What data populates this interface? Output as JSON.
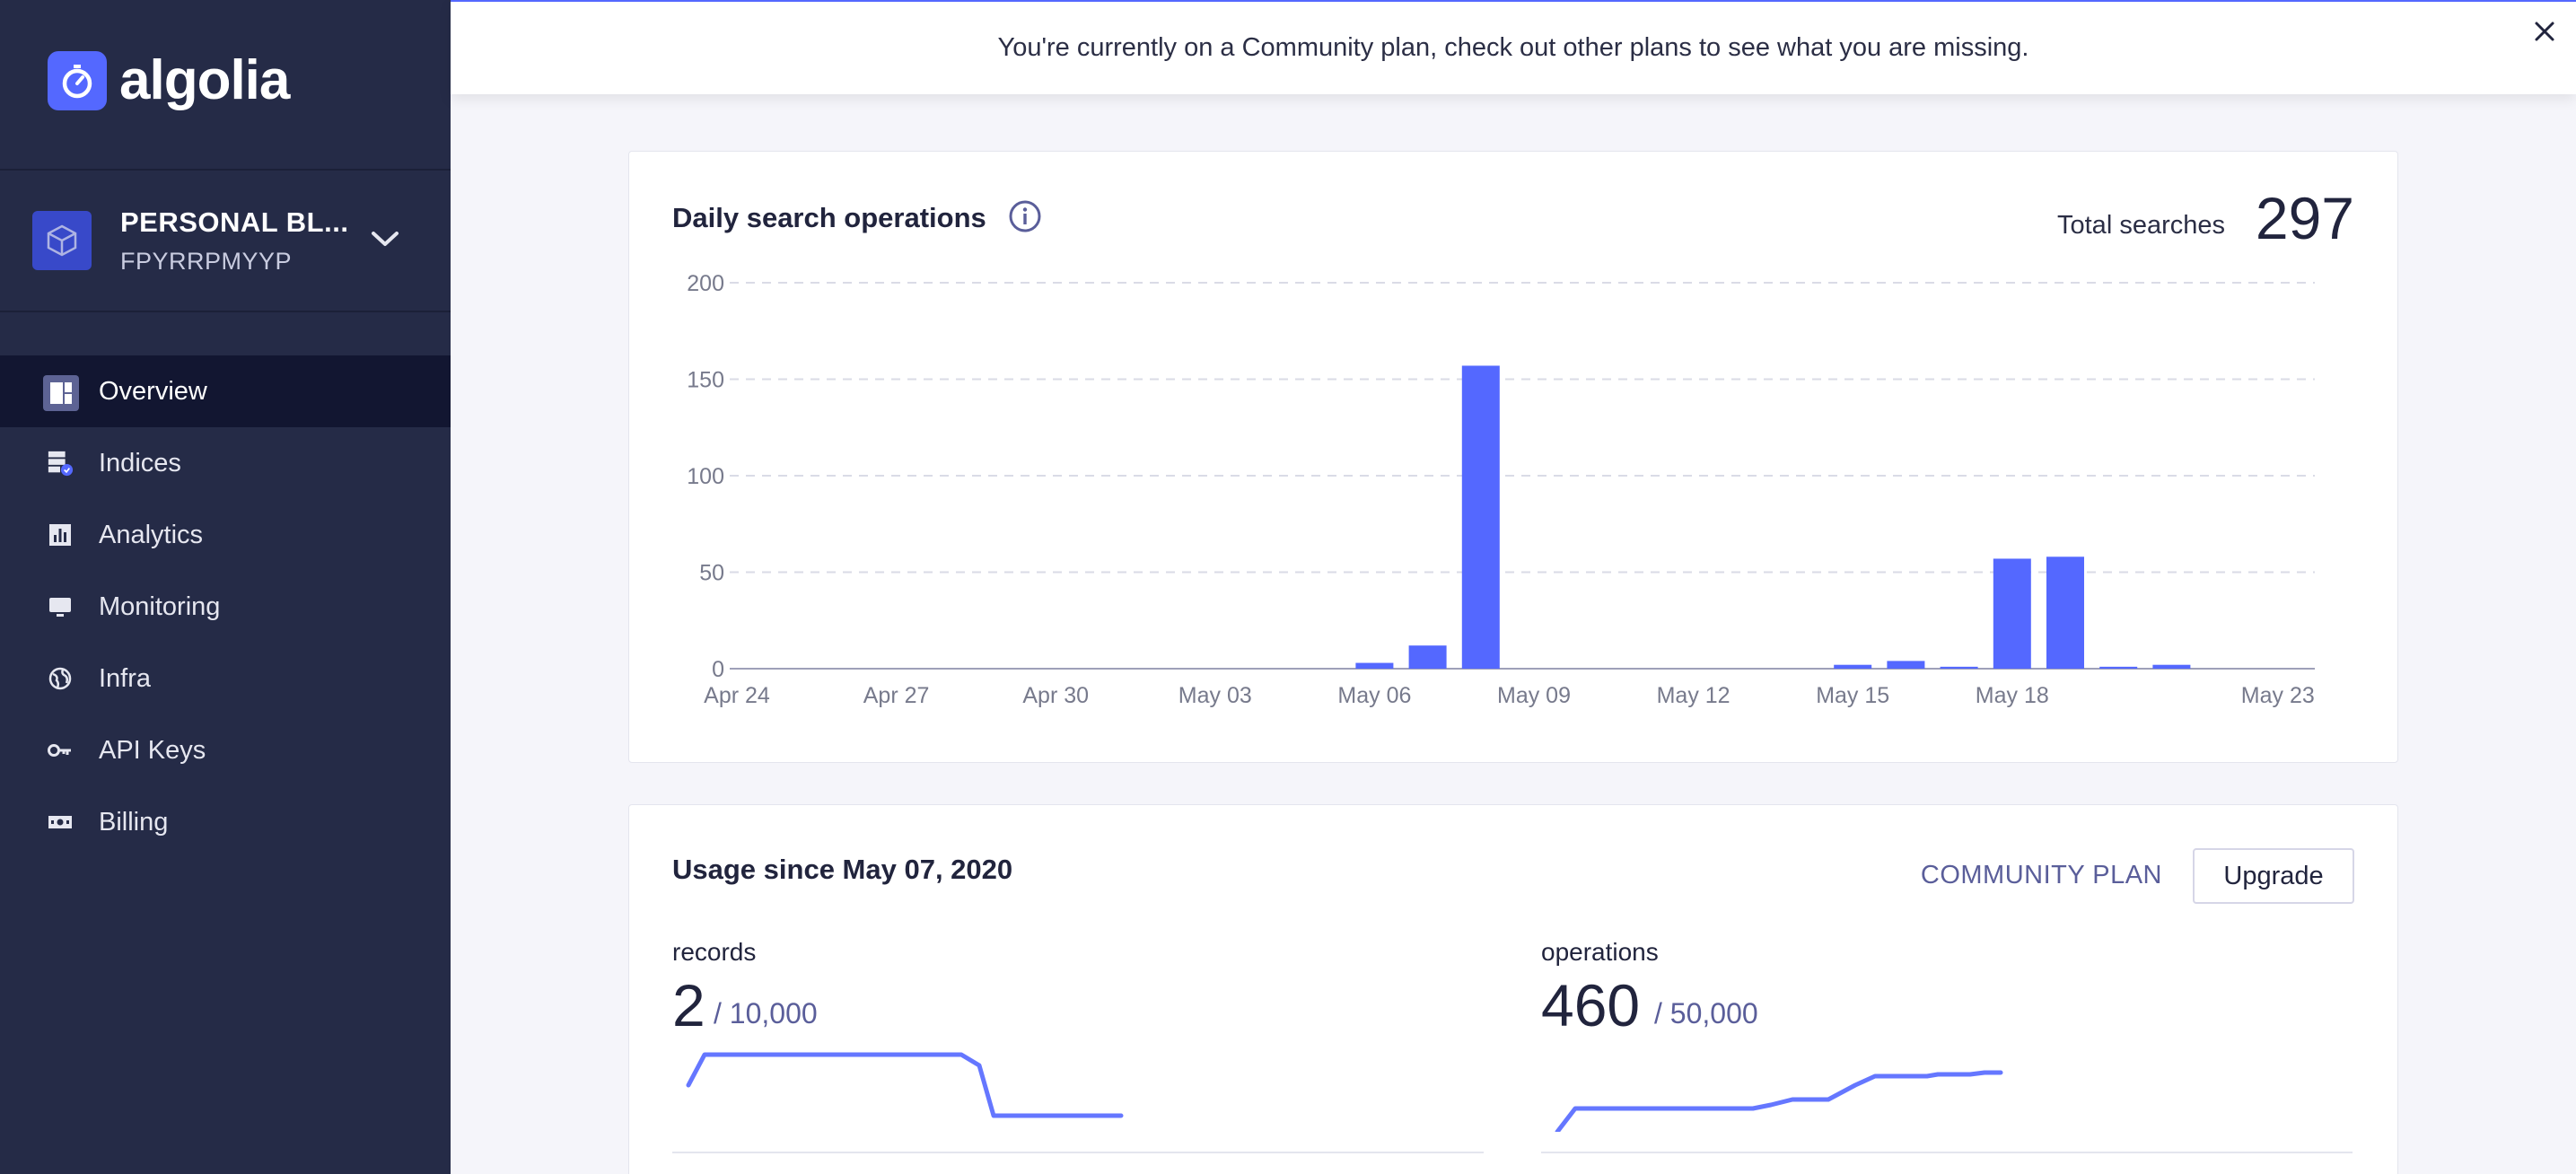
{
  "brand": {
    "name": "algolia",
    "accent": "#5468ff"
  },
  "app": {
    "name": "PERSONAL BL...",
    "id": "FPYRRPMYYP"
  },
  "nav": {
    "items": [
      {
        "label": "Overview",
        "icon": "overview-icon",
        "active": true
      },
      {
        "label": "Indices",
        "icon": "indices-icon"
      },
      {
        "label": "Analytics",
        "icon": "analytics-icon"
      },
      {
        "label": "Monitoring",
        "icon": "monitoring-icon"
      },
      {
        "label": "Infra",
        "icon": "globe-icon"
      },
      {
        "label": "API Keys",
        "icon": "key-icon"
      },
      {
        "label": "Billing",
        "icon": "billing-icon"
      }
    ]
  },
  "banner": {
    "text": "You're currently on a Community plan, check out other plans to see what you are missing."
  },
  "search_card": {
    "title": "Daily search operations",
    "total_label": "Total searches",
    "total_value": "297"
  },
  "chart_data": {
    "type": "bar",
    "x_tick_labels": [
      "Apr 24",
      "Apr 27",
      "Apr 30",
      "May 03",
      "May 06",
      "May 09",
      "May 12",
      "May 15",
      "May 18",
      "May 23"
    ],
    "x_tick_dates": [
      "2020-04-24",
      "2020-04-27",
      "2020-04-30",
      "2020-05-03",
      "2020-05-06",
      "2020-05-09",
      "2020-05-12",
      "2020-05-15",
      "2020-05-18",
      "2020-05-23"
    ],
    "series": [
      {
        "x": [
          "2020-05-06",
          "2020-05-07",
          "2020-05-08",
          "2020-05-15",
          "2020-05-16",
          "2020-05-17",
          "2020-05-18",
          "2020-05-19",
          "2020-05-20",
          "2020-05-21"
        ],
        "values": [
          3,
          12,
          157,
          2,
          4,
          1,
          57,
          58,
          1,
          2
        ]
      }
    ],
    "y_ticks": [
      0,
      50,
      100,
      150,
      200
    ],
    "ylim": [
      0,
      200
    ],
    "grid": true,
    "color": "#5468ff"
  },
  "usage_card": {
    "title": "Usage since May 07, 2020",
    "plan_label": "COMMUNITY PLAN",
    "upgrade_label": "Upgrade",
    "records": {
      "label": "records",
      "value": "2",
      "max": "/ 10,000"
    },
    "operations": {
      "label": "operations",
      "value": "460",
      "max": "/ 50,000"
    }
  }
}
